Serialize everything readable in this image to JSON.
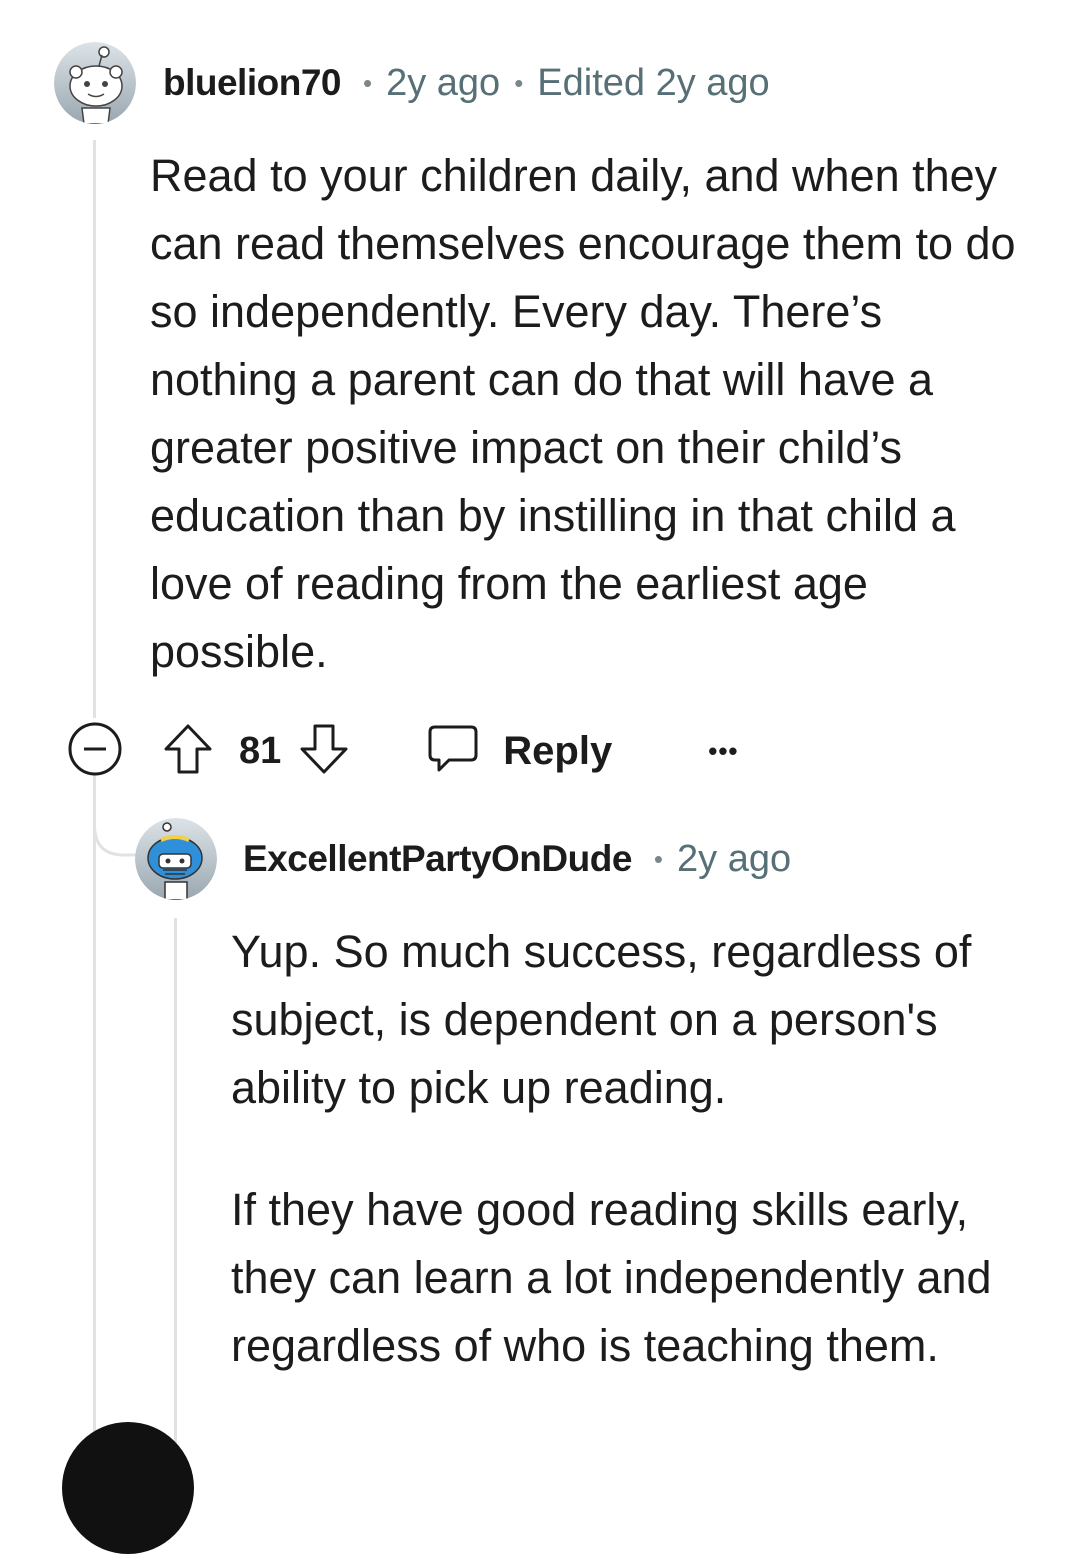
{
  "comments": [
    {
      "username": "bluelion70",
      "time": "2y ago",
      "edited": "Edited 2y ago",
      "avatar_icon": "snoo-avatar-icon",
      "paragraphs": [
        "Read to your children daily, and when they can read themselves encourage them to do so independently. Every day. There’s nothing a parent can do that will have a greater positive impact on their child’s education than by instilling in that child a love of reading from the earliest age possible."
      ],
      "score": "81",
      "reply_label": "Reply",
      "more_label": "•••"
    },
    {
      "username": "ExcellentPartyOnDude",
      "time": "2y ago",
      "avatar_icon": "helmet-snoo-avatar-icon",
      "paragraphs": [
        "Yup. So much success, regardless of subject, is dependent on a person's ability to pick up reading.",
        "If they have good reading skills early, they can learn a lot independently and regardless of who is teaching them."
      ]
    }
  ],
  "icons": {
    "collapse": "collapse-icon",
    "upvote": "upvote-arrow-icon",
    "downvote": "downvote-arrow-icon",
    "reply": "comment-bubble-icon",
    "more": "more-options-icon"
  },
  "colors": {
    "text": "#1c1c1c",
    "meta": "#576f76",
    "thread_line": "#dfe3e6"
  }
}
